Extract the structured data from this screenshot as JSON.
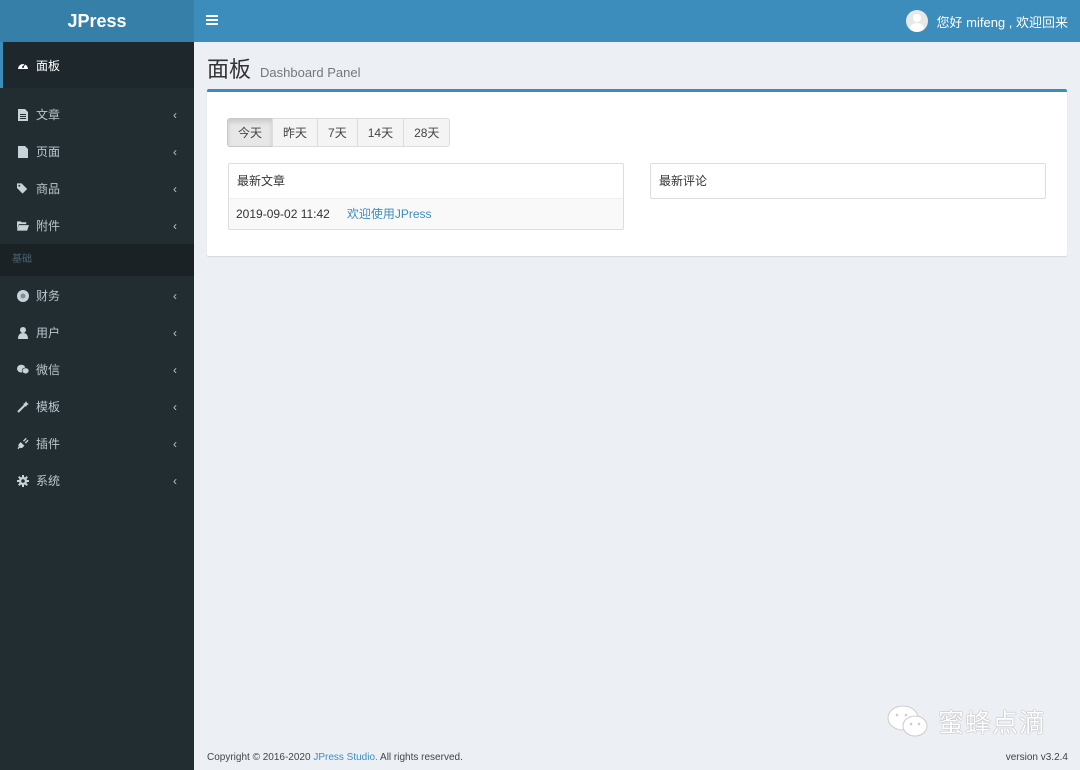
{
  "app": {
    "logo": "JPress",
    "greeting": "您好 mifeng , 欢迎回来"
  },
  "sidebar": {
    "active": {
      "label": "面板",
      "icon": "dashboard-icon"
    },
    "items": [
      {
        "label": "文章",
        "icon": "file-text-icon"
      },
      {
        "label": "页面",
        "icon": "file-icon"
      },
      {
        "label": "商品",
        "icon": "tags-icon"
      },
      {
        "label": "附件",
        "icon": "folder-open-icon"
      }
    ],
    "section_header": "基础",
    "items2": [
      {
        "label": "财务",
        "icon": "finance-icon"
      },
      {
        "label": "用户",
        "icon": "user-icon"
      },
      {
        "label": "微信",
        "icon": "wechat-icon"
      },
      {
        "label": "模板",
        "icon": "magic-wand-icon"
      },
      {
        "label": "插件",
        "icon": "plug-icon"
      },
      {
        "label": "系统",
        "icon": "gear-icon"
      }
    ],
    "chevron": "‹"
  },
  "page": {
    "title": "面板",
    "subtitle": "Dashboard Panel"
  },
  "range_tabs": [
    {
      "label": "今天",
      "active": true
    },
    {
      "label": "昨天",
      "active": false
    },
    {
      "label": "7天",
      "active": false
    },
    {
      "label": "14天",
      "active": false
    },
    {
      "label": "28天",
      "active": false
    }
  ],
  "latest_articles": {
    "title": "最新文章",
    "rows": [
      {
        "date": "2019-09-02 11:42",
        "title": "欢迎使用JPress"
      }
    ]
  },
  "latest_comments": {
    "title": "最新评论"
  },
  "watermark": "蜜蜂点滴",
  "footer": {
    "copyright_prefix": "Copyright © 2016-2020 ",
    "studio_link": "JPress Studio.",
    "copyright_suffix": " All rights reserved.",
    "version": "version v3.2.4"
  },
  "colors": {
    "brand": "#3c8dbc",
    "sidebar_bg": "#222d32",
    "page_bg": "#ecf0f5"
  }
}
